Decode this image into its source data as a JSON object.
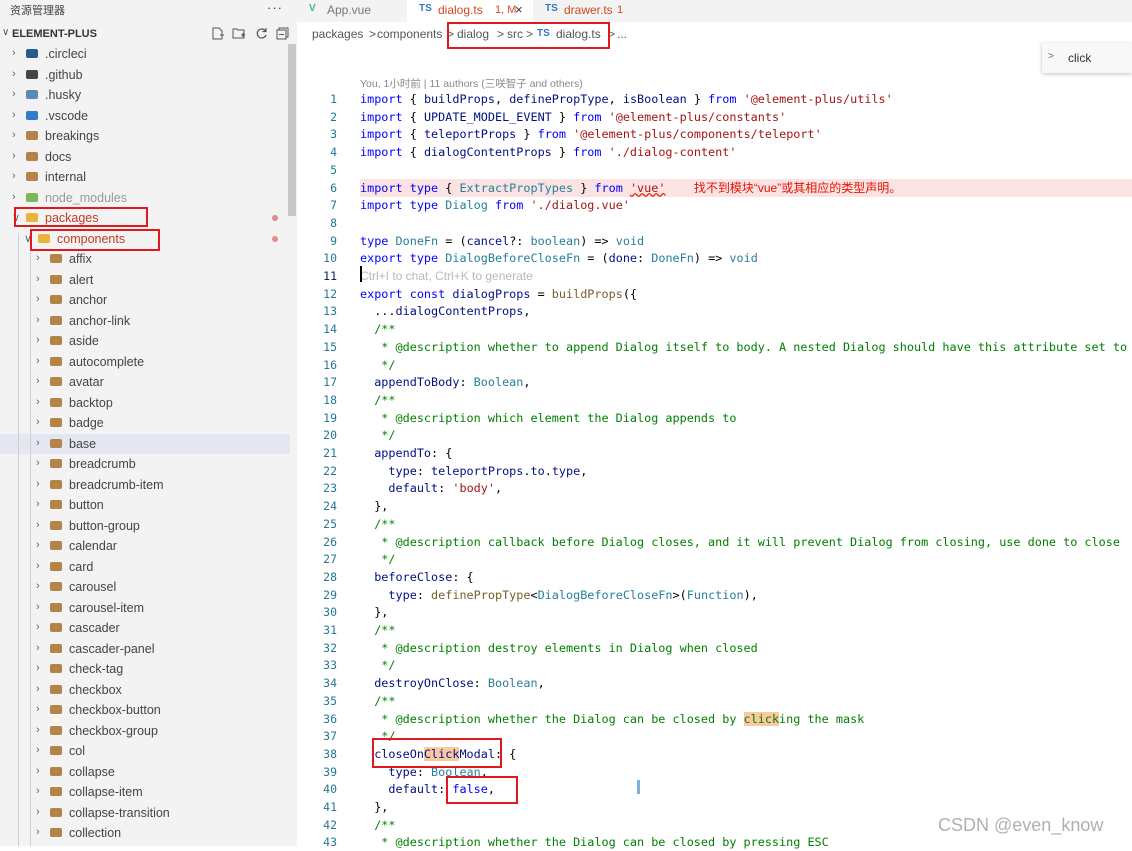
{
  "sidebar": {
    "title": "资源管理器",
    "more_label": "···",
    "section_label": "ELEMENT-PLUS",
    "actions": [
      "new-file-icon",
      "new-folder-icon",
      "refresh-icon",
      "collapse-all-icon"
    ],
    "items": [
      {
        "label": ".circleci",
        "icon": "circleci-icon",
        "color": "#2c5a8c"
      },
      {
        "label": ".github",
        "icon": "github-icon",
        "color": "#444444"
      },
      {
        "label": ".husky",
        "icon": "husky-icon",
        "color": "#5b89b8"
      },
      {
        "label": ".vscode",
        "icon": "vscode-icon",
        "color": "#2f7dd1"
      },
      {
        "label": "breakings",
        "icon": "folder-icon",
        "color": "#b3834a"
      },
      {
        "label": "docs",
        "icon": "folder-icon",
        "color": "#b3834a"
      },
      {
        "label": "internal",
        "icon": "folder-icon",
        "color": "#b3834a"
      },
      {
        "label": "node_modules",
        "icon": "node-folder-icon",
        "color": "#7bb85a"
      },
      {
        "label": "packages",
        "icon": "open-folder-icon",
        "color": "#e8b33a"
      },
      {
        "label": "components",
        "icon": "open-folder-icon",
        "color": "#e8b33a"
      },
      {
        "label": "affix",
        "icon": "folder-icon",
        "color": "#b3834a"
      },
      {
        "label": "alert",
        "icon": "folder-icon",
        "color": "#b3834a"
      },
      {
        "label": "anchor",
        "icon": "folder-icon",
        "color": "#b3834a"
      },
      {
        "label": "anchor-link",
        "icon": "folder-icon",
        "color": "#b3834a"
      },
      {
        "label": "aside",
        "icon": "folder-icon",
        "color": "#b3834a"
      },
      {
        "label": "autocomplete",
        "icon": "folder-icon",
        "color": "#b3834a"
      },
      {
        "label": "avatar",
        "icon": "folder-icon",
        "color": "#b3834a"
      },
      {
        "label": "backtop",
        "icon": "folder-icon",
        "color": "#b3834a"
      },
      {
        "label": "badge",
        "icon": "folder-icon",
        "color": "#b3834a"
      },
      {
        "label": "base",
        "icon": "folder-icon",
        "color": "#b3834a"
      },
      {
        "label": "breadcrumb",
        "icon": "folder-icon",
        "color": "#b3834a"
      },
      {
        "label": "breadcrumb-item",
        "icon": "folder-icon",
        "color": "#b3834a"
      },
      {
        "label": "button",
        "icon": "folder-icon",
        "color": "#b3834a"
      },
      {
        "label": "button-group",
        "icon": "folder-icon",
        "color": "#b3834a"
      },
      {
        "label": "calendar",
        "icon": "folder-icon",
        "color": "#b3834a"
      },
      {
        "label": "card",
        "icon": "folder-icon",
        "color": "#b3834a"
      },
      {
        "label": "carousel",
        "icon": "folder-icon",
        "color": "#b3834a"
      },
      {
        "label": "carousel-item",
        "icon": "folder-icon",
        "color": "#b3834a"
      },
      {
        "label": "cascader",
        "icon": "folder-icon",
        "color": "#b3834a"
      },
      {
        "label": "cascader-panel",
        "icon": "folder-icon",
        "color": "#b3834a"
      },
      {
        "label": "check-tag",
        "icon": "folder-icon",
        "color": "#b3834a"
      },
      {
        "label": "checkbox",
        "icon": "folder-icon",
        "color": "#b3834a"
      },
      {
        "label": "checkbox-button",
        "icon": "folder-icon",
        "color": "#b3834a"
      },
      {
        "label": "checkbox-group",
        "icon": "folder-icon",
        "color": "#b3834a"
      },
      {
        "label": "col",
        "icon": "folder-icon",
        "color": "#b3834a"
      },
      {
        "label": "collapse",
        "icon": "folder-icon",
        "color": "#b3834a"
      },
      {
        "label": "collapse-item",
        "icon": "folder-icon",
        "color": "#b3834a"
      },
      {
        "label": "collapse-transition",
        "icon": "folder-icon",
        "color": "#b3834a"
      },
      {
        "label": "collection",
        "icon": "folder-icon",
        "color": "#b3834a"
      }
    ]
  },
  "tabs": [
    {
      "label": "App.vue",
      "icon": "vue-icon",
      "icon_text": "V",
      "color": "#41b883"
    },
    {
      "label": "dialog.ts",
      "badge": "1, M",
      "icon": "ts-icon",
      "icon_text": "TS",
      "color": "#3178c6",
      "close": "×"
    },
    {
      "label": "drawer.ts",
      "badge": "1",
      "icon": "ts-icon",
      "icon_text": "TS",
      "color": "#3178c6"
    }
  ],
  "breadcrumb": {
    "parts": [
      "packages",
      "components",
      "dialog",
      "src"
    ],
    "file_icon": "TS",
    "file": "dialog.ts",
    "more": "...",
    "sep": ">"
  },
  "find_widget": {
    "expand_icon": ">",
    "value": "click"
  },
  "blame_text": "You, 1小时前 | 11 authors (三咲智子 and others)",
  "editor": {
    "error_message": "找不到模块“vue”或其相应的类型声明。",
    "inline_hint": "Ctrl+I to chat, Ctrl+K to generate",
    "line_numbers": [
      "1",
      "2",
      "3",
      "4",
      "5",
      "6",
      "7",
      "8",
      "9",
      "10",
      "11",
      "12",
      "13",
      "14",
      "15",
      "16",
      "17",
      "18",
      "19",
      "20",
      "21",
      "22",
      "23",
      "24",
      "25",
      "26",
      "27",
      "28",
      "29",
      "30",
      "31",
      "32",
      "33",
      "34",
      "35",
      "36",
      "37",
      "38",
      "39",
      "40",
      "41",
      "42",
      "43"
    ]
  },
  "code": [
    [
      [
        "k",
        "import"
      ],
      [
        "p",
        " { "
      ],
      [
        "v",
        "buildProps"
      ],
      [
        "p",
        ", "
      ],
      [
        "v",
        "definePropType"
      ],
      [
        "p",
        ", "
      ],
      [
        "v",
        "isBoolean"
      ],
      [
        "p",
        " } "
      ],
      [
        "k",
        "from"
      ],
      [
        "s",
        " '@element-plus/utils'"
      ]
    ],
    [
      [
        "k",
        "import"
      ],
      [
        "p",
        " { "
      ],
      [
        "v",
        "UPDATE_MODEL_EVENT"
      ],
      [
        "p",
        " } "
      ],
      [
        "k",
        "from"
      ],
      [
        "s",
        " '@element-plus/constants'"
      ]
    ],
    [
      [
        "k",
        "import"
      ],
      [
        "p",
        " { "
      ],
      [
        "v",
        "teleportProps"
      ],
      [
        "p",
        " } "
      ],
      [
        "k",
        "from"
      ],
      [
        "s",
        " '@element-plus/components/teleport'"
      ]
    ],
    [
      [
        "k",
        "import"
      ],
      [
        "p",
        " { "
      ],
      [
        "v",
        "dialogContentProps"
      ],
      [
        "p",
        " } "
      ],
      [
        "k",
        "from"
      ],
      [
        "s",
        " './dialog-content'"
      ]
    ],
    [],
    [
      [
        "k",
        "import"
      ],
      [
        "d",
        " type"
      ],
      [
        "p",
        " { "
      ],
      [
        "t",
        "ExtractPropTypes"
      ],
      [
        "p",
        " } "
      ],
      [
        "k",
        "from"
      ],
      [
        "p",
        " "
      ],
      [
        "sq",
        "'vue'"
      ],
      [
        "p",
        "    "
      ],
      [
        "err",
        "找不到模块“vue”或其相应的类型声明。"
      ]
    ],
    [
      [
        "k",
        "import"
      ],
      [
        "d",
        " type"
      ],
      [
        "t",
        " Dialog"
      ],
      [
        "k",
        " from"
      ],
      [
        "s",
        " './dialog.vue'"
      ]
    ],
    [],
    [
      [
        "d",
        "type"
      ],
      [
        "t",
        " DoneFn"
      ],
      [
        "p",
        " = ("
      ],
      [
        "v",
        "cancel"
      ],
      [
        "p",
        "?: "
      ],
      [
        "t",
        "boolean"
      ],
      [
        "p",
        ") => "
      ],
      [
        "t",
        "void"
      ]
    ],
    [
      [
        "k",
        "export"
      ],
      [
        "d",
        " type"
      ],
      [
        "t",
        " DialogBeforeCloseFn"
      ],
      [
        "p",
        " = ("
      ],
      [
        "v",
        "done"
      ],
      [
        "p",
        ": "
      ],
      [
        "t",
        "DoneFn"
      ],
      [
        "p",
        ") => "
      ],
      [
        "t",
        "void"
      ]
    ],
    [
      [
        "hint",
        "Ctrl+I to chat, Ctrl+K to generate"
      ]
    ],
    [
      [
        "k",
        "export"
      ],
      [
        "d",
        " const"
      ],
      [
        "v",
        " dialogProps"
      ],
      [
        "p",
        " = "
      ],
      [
        "f",
        "buildProps"
      ],
      [
        "p",
        "({"
      ]
    ],
    [
      [
        "p",
        "  ..."
      ],
      [
        "v",
        "dialogContentProps"
      ],
      [
        "p",
        ","
      ]
    ],
    [
      [
        "c",
        "  /**"
      ]
    ],
    [
      [
        "c",
        "   * @description whether to append Dialog itself to body. A nested Dialog should have this attribute set to"
      ]
    ],
    [
      [
        "c",
        "   */"
      ]
    ],
    [
      [
        "v",
        "  appendToBody"
      ],
      [
        "p",
        ": "
      ],
      [
        "t",
        "Boolean"
      ],
      [
        "p",
        ","
      ]
    ],
    [
      [
        "c",
        "  /**"
      ]
    ],
    [
      [
        "c",
        "   * @description which element the Dialog appends to"
      ]
    ],
    [
      [
        "c",
        "   */"
      ]
    ],
    [
      [
        "v",
        "  appendTo"
      ],
      [
        "p",
        ": {"
      ]
    ],
    [
      [
        "v",
        "    type"
      ],
      [
        "p",
        ": "
      ],
      [
        "v",
        "teleportProps"
      ],
      [
        "p",
        "."
      ],
      [
        "v",
        "to"
      ],
      [
        "p",
        "."
      ],
      [
        "v",
        "type"
      ],
      [
        "p",
        ","
      ]
    ],
    [
      [
        "v",
        "    default"
      ],
      [
        "p",
        ": "
      ],
      [
        "s",
        "'body'"
      ],
      [
        "p",
        ","
      ]
    ],
    [
      [
        "p",
        "  },"
      ]
    ],
    [
      [
        "c",
        "  /**"
      ]
    ],
    [
      [
        "c",
        "   * @description callback before Dialog closes, and it will prevent Dialog from closing, use done to close"
      ]
    ],
    [
      [
        "c",
        "   */"
      ]
    ],
    [
      [
        "v",
        "  beforeClose"
      ],
      [
        "p",
        ": {"
      ]
    ],
    [
      [
        "v",
        "    type"
      ],
      [
        "p",
        ": "
      ],
      [
        "f",
        "definePropType"
      ],
      [
        "p",
        "<"
      ],
      [
        "t",
        "DialogBeforeCloseFn"
      ],
      [
        "p",
        ">("
      ],
      [
        "t",
        "Function"
      ],
      [
        "p",
        "),"
      ]
    ],
    [
      [
        "p",
        "  },"
      ]
    ],
    [
      [
        "c",
        "  /**"
      ]
    ],
    [
      [
        "c",
        "   * @description destroy elements in Dialog when closed"
      ]
    ],
    [
      [
        "c",
        "   */"
      ]
    ],
    [
      [
        "v",
        "  destroyOnClose"
      ],
      [
        "p",
        ": "
      ],
      [
        "t",
        "Boolean"
      ],
      [
        "p",
        ","
      ]
    ],
    [
      [
        "c",
        "  /**"
      ]
    ],
    [
      [
        "c",
        "   * @description whether the Dialog can be closed by "
      ],
      [
        "findc",
        "click"
      ],
      [
        "c",
        "ing the mask"
      ]
    ],
    [
      [
        "c",
        "   */"
      ]
    ],
    [
      [
        "v",
        "  closeOn"
      ],
      [
        "findv",
        "Click"
      ],
      [
        "v",
        "Modal"
      ],
      [
        "p",
        ": {"
      ]
    ],
    [
      [
        "v",
        "    type"
      ],
      [
        "p",
        ": "
      ],
      [
        "t",
        "Boolean"
      ],
      [
        "p",
        ","
      ]
    ],
    [
      [
        "v",
        "    default"
      ],
      [
        "p",
        ": "
      ],
      [
        "d",
        "false"
      ],
      [
        "p",
        ","
      ]
    ],
    [
      [
        "p",
        "  },"
      ]
    ],
    [
      [
        "c",
        "  /**"
      ]
    ],
    [
      [
        "c",
        "   * @description whether the Dialog can be closed by pressing ESC"
      ]
    ]
  ],
  "watermark": "CSDN @even_know"
}
